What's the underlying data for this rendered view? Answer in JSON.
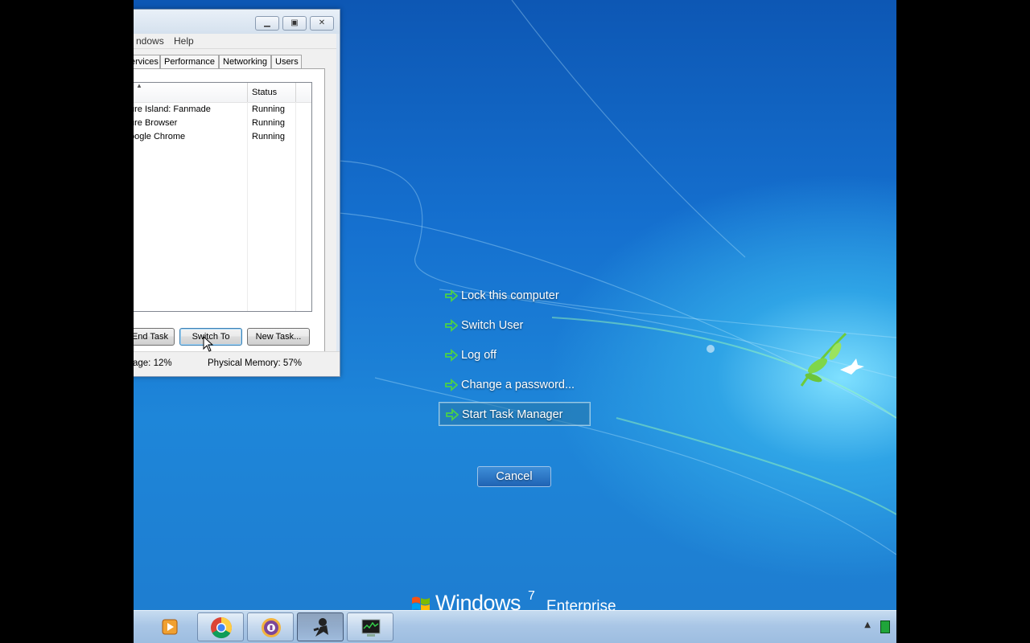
{
  "task_manager": {
    "menu": [
      "ndows",
      "Help"
    ],
    "tabs": [
      "ervices",
      "Performance",
      "Networking",
      "Users"
    ],
    "column_status": "Status",
    "tasks": [
      {
        "name": "ure Island: Fanmade",
        "status": "Running"
      },
      {
        "name": "ure Browser",
        "status": "Running"
      },
      {
        "name": "oogle Chrome",
        "status": "Running"
      }
    ],
    "buttons": {
      "end_task": "End Task",
      "switch_to": "Switch To",
      "new_task": "New Task..."
    },
    "status_cpu": "age: 12%",
    "status_memory": "Physical Memory: 57%"
  },
  "security_options": {
    "items": [
      "Lock this computer",
      "Switch User",
      "Log off",
      "Change a password...",
      "Start Task Manager"
    ],
    "selected": "Start Task Manager",
    "cancel": "Cancel"
  },
  "brand": {
    "name": "Windows",
    "version": "7",
    "edition": "Enterprise"
  },
  "taskbar": {
    "apps": [
      "media-player-icon",
      "chrome-icon",
      "tor-browser-icon",
      "game-icon",
      "task-manager-icon"
    ],
    "colors": {
      "accent_green": "#34b34a",
      "selection": "#2878aa"
    }
  }
}
